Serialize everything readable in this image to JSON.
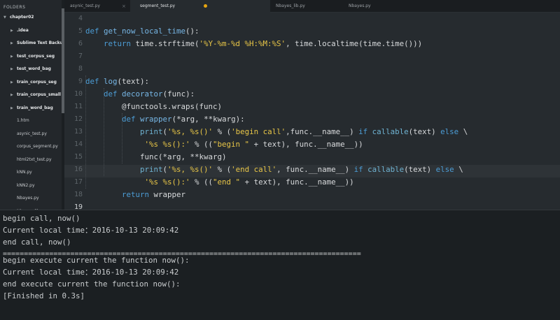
{
  "sidebar": {
    "header": "FOLDERS",
    "items": [
      {
        "label": "chapter02",
        "type": "folder",
        "level": 0,
        "open": true
      },
      {
        "label": ".idea",
        "type": "folder",
        "level": 1,
        "open": false
      },
      {
        "label": "Sublime Text Backups",
        "type": "folder",
        "level": 1,
        "open": false
      },
      {
        "label": "test_corpus_seg",
        "type": "folder",
        "level": 1,
        "open": false
      },
      {
        "label": "test_word_bag",
        "type": "folder",
        "level": 1,
        "open": false
      },
      {
        "label": "train_corpus_seg",
        "type": "folder",
        "level": 1,
        "open": false
      },
      {
        "label": "train_corpus_small",
        "type": "folder",
        "level": 1,
        "open": false
      },
      {
        "label": "train_word_bag",
        "type": "folder",
        "level": 1,
        "open": false
      },
      {
        "label": "1.htm",
        "type": "file",
        "level": 1
      },
      {
        "label": "asynic_test.py",
        "type": "file",
        "level": 1
      },
      {
        "label": "corpus_segment.py",
        "type": "file",
        "level": 1
      },
      {
        "label": "html2txt_test.py",
        "type": "file",
        "level": 1
      },
      {
        "label": "kNN.py",
        "type": "file",
        "level": 1
      },
      {
        "label": "kNN2.py",
        "type": "file",
        "level": 1
      },
      {
        "label": "Nbayes.py",
        "type": "file",
        "level": 1
      },
      {
        "label": "Nbayes_lib.py",
        "type": "file",
        "level": 1
      },
      {
        "label": "pickle_test.py",
        "type": "file",
        "level": 1
      },
      {
        "label": "Predict.py",
        "type": "file",
        "level": 1
      }
    ]
  },
  "tabs": [
    {
      "label": "asynic_test.py",
      "active": false,
      "dirty": false
    },
    {
      "label": "segment_test.py",
      "active": true,
      "dirty": true
    },
    {
      "label": "Nbayes_lib.py",
      "active": false,
      "dirty": false
    },
    {
      "label": "Nbayes.py",
      "active": false,
      "dirty": false
    }
  ],
  "editor": {
    "current_line": 19,
    "line_numbers": [
      "4",
      "5",
      "6",
      "7",
      "8",
      "9",
      "10",
      "11",
      "12",
      "13",
      "14",
      "15",
      "16",
      "17",
      "18",
      "19",
      "20",
      "21",
      "22"
    ]
  },
  "console": {
    "lines": [
      "begin call, now()",
      "Current local time：2016-10-13 20:09:42",
      "end call, now()",
      "=====================================================================================",
      "begin execute current the function now():",
      "Current local time：2016-10-13 20:09:42",
      "end execute current the function now():",
      "[Finished in 0.3s]"
    ]
  },
  "colors": {
    "keyword": "#4c9dd6",
    "string": "#e7c547",
    "dirty_dot": "#e6a40f"
  }
}
